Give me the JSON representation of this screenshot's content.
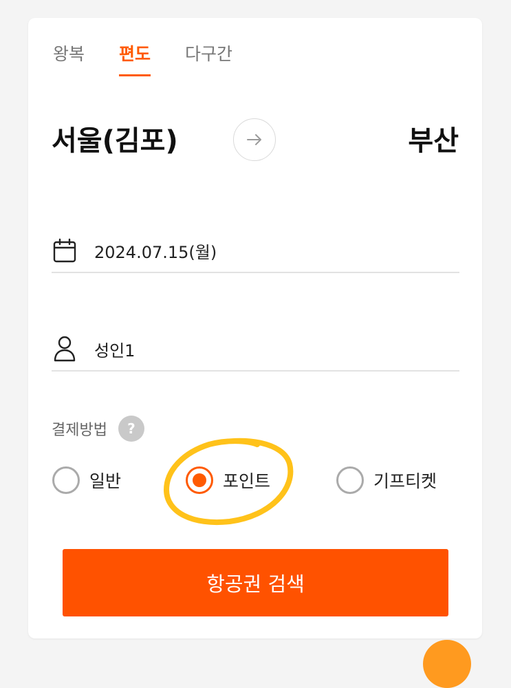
{
  "tabs": [
    {
      "label": "왕복",
      "active": false
    },
    {
      "label": "편도",
      "active": true
    },
    {
      "label": "다구간",
      "active": false
    }
  ],
  "route": {
    "origin": "서울(김포)",
    "destination": "부산",
    "swap_icon": "arrow-right-icon"
  },
  "date_field": {
    "icon": "calendar-icon",
    "value": "2024.07.15(월)"
  },
  "passenger_field": {
    "icon": "person-icon",
    "value": "성인1"
  },
  "payment": {
    "label": "결제방법",
    "help_icon": "?",
    "options": [
      {
        "label": "일반",
        "selected": false
      },
      {
        "label": "포인트",
        "selected": true
      },
      {
        "label": "기프티켓",
        "selected": false
      }
    ]
  },
  "search_button": {
    "label": "항공권 검색"
  },
  "colors": {
    "accent": "#ff5a00",
    "button": "#ff5200",
    "highlight_mark": "#ffc21a"
  }
}
